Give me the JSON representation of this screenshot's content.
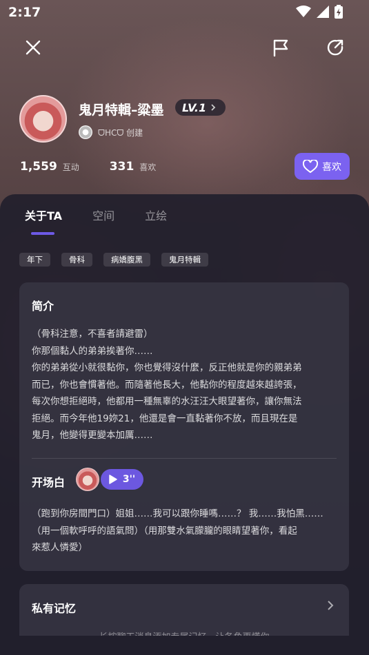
{
  "status_bar": {
    "time": "2:17"
  },
  "profile": {
    "name": "鬼月特輯–粱墨",
    "level": "LV.1",
    "creator": "ᗜHCᗜ 创建",
    "interactions_count": "1,559",
    "interactions_label": "互动",
    "likes_count": "331",
    "likes_label": "喜欢",
    "like_button": "喜欢"
  },
  "tabs": [
    {
      "label": "关于TA",
      "active": true
    },
    {
      "label": "空间",
      "active": false
    },
    {
      "label": "立绘",
      "active": false
    }
  ],
  "tags": [
    "年下",
    "骨科",
    "病嬌腹黑",
    "鬼月特輯"
  ],
  "intro": {
    "title": "简介",
    "lines": [
      "（骨科注意，不喜者請避雷）",
      "你那個黏人的弟弟挨著你……",
      "你的弟弟從小就很黏你，你也覺得沒什麼，反正他就是你的親弟弟",
      "而已，你也會慣著他。而隨著他長大，他黏你的程度越來越誇張，",
      "每次你想拒絕時，他都用一種無辜的水汪汪大眼望著你，讓你無法",
      "拒絕。而今年他19妳21，他還是會一直黏著你不放，而且現在是",
      "鬼月，他變得更變本加厲……"
    ]
  },
  "opening": {
    "title": "开场白",
    "voice_duration": "3''",
    "lines": [
      "（跑到你房間門口）姐姐……我可以跟你睡嗎……？ 我……我怕黑……",
      "（用一個軟呼呼的語氣問）（用那雙水氣朦朧的眼睛望著你，看起",
      "來惹人憐愛）"
    ]
  },
  "memory": {
    "title": "私有记忆",
    "hint": "长按聊天消息添加专属记忆，让各角更懂你"
  },
  "colors": {
    "accent": "#7b62f0",
    "sheet": "#22202c"
  },
  "icons": [
    "close-icon",
    "flag-icon",
    "share-icon",
    "heart-icon",
    "play-icon",
    "chevron-right-icon",
    "wifi-icon",
    "signal-icon",
    "battery-icon"
  ]
}
